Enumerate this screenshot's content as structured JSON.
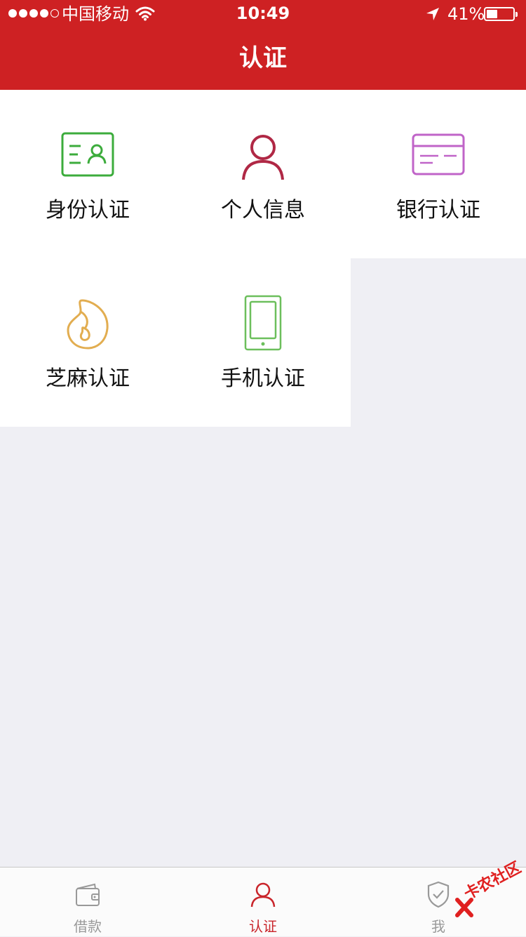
{
  "status_bar": {
    "carrier": "中国移动",
    "time": "10:49",
    "battery_percent": "41%",
    "battery_level": 0.41,
    "signal_bars_filled": 4,
    "signal_bars_total": 5
  },
  "nav": {
    "title": "认证"
  },
  "grid": {
    "items": [
      {
        "label": "身份认证",
        "icon": "id-card-icon",
        "color": "#3cac3c"
      },
      {
        "label": "个人信息",
        "icon": "person-icon",
        "color": "#b02845"
      },
      {
        "label": "银行认证",
        "icon": "bank-card-icon",
        "color": "#c064c8"
      },
      {
        "label": "芝麻认证",
        "icon": "sesame-icon",
        "color": "#e2ad50"
      },
      {
        "label": "手机认证",
        "icon": "phone-icon",
        "color": "#6cbf5c"
      }
    ]
  },
  "tabbar": {
    "items": [
      {
        "label": "借款",
        "icon": "wallet-icon",
        "active": false
      },
      {
        "label": "认证",
        "icon": "person-icon",
        "active": true
      },
      {
        "label": "我",
        "icon": "shield-check-icon",
        "active": false
      }
    ],
    "active_color": "#c9252b",
    "inactive_color": "#999999"
  },
  "watermark": {
    "text": "卡农社区"
  },
  "colors": {
    "header_bg": "#ce2123",
    "page_bg": "#efeff4"
  }
}
